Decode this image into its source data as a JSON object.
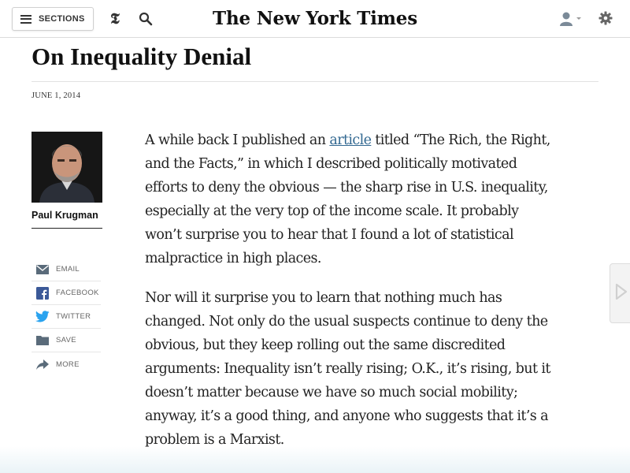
{
  "header": {
    "sections_label": "SECTIONS",
    "logo_text": "The New York Times"
  },
  "article": {
    "headline": "On Inequality Denial",
    "date": "JUNE 1, 2014",
    "author": "Paul Krugman",
    "paragraphs": [
      {
        "before_link": "A while back I published an ",
        "link_text": "article",
        "after_link": " titled “The Rich, the Right, and the Facts,” in which I described politically motivated efforts to deny the obvious — the sharp rise in U.S. inequality, especially at the very top of the income scale. It probably won’t surprise you to hear that I found a lot of statistical malpractice in high places."
      },
      {
        "text": "Nor will it surprise you to learn that nothing much has changed. Not only do the usual suspects continue to deny the obvious, but they keep rolling out the same discredited arguments: Inequality isn’t really rising; O.K., it’s rising, but it doesn’t matter because we have so much social mobility; anyway, it’s a good thing, and anyone who suggests that it’s a problem is a Marxist."
      }
    ]
  },
  "share": [
    {
      "label": "EMAIL",
      "icon": "email-icon"
    },
    {
      "label": "FACEBOOK",
      "icon": "facebook-icon"
    },
    {
      "label": "TWITTER",
      "icon": "twitter-icon"
    },
    {
      "label": "SAVE",
      "icon": "save-icon"
    },
    {
      "label": "MORE",
      "icon": "more-icon"
    }
  ],
  "colors": {
    "link": "#326891",
    "icon_gray": "#5a6b7a",
    "facebook": "#3b5998",
    "twitter": "#2aa3ef"
  }
}
